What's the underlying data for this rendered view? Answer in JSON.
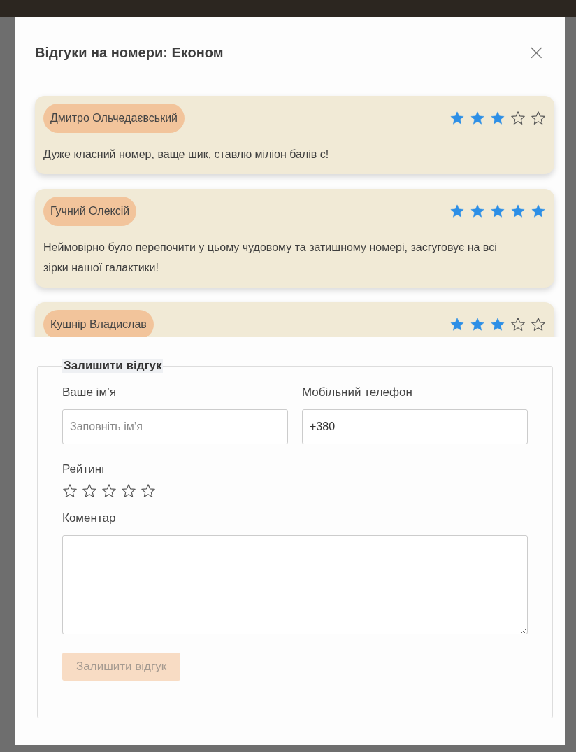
{
  "modal": {
    "title": "Відгуки на номери: Економ",
    "close": "×"
  },
  "reviews": [
    {
      "name": "Дмитро Ольчедаєвський",
      "stars": 3,
      "text": "Дуже класний номер, ваще шик, ставлю міліон балів с!"
    },
    {
      "name": "Гучний Олексій",
      "stars": 5,
      "text": "Неймовірно було перепочити у цьому чудовому та затишному номері, засгуговує на всі зірки нашої галактики!"
    },
    {
      "name": "Кушнір Владислав",
      "stars": 3
    }
  ],
  "form": {
    "legend": "Залишити відгук",
    "name_label": "Ваше ім’я",
    "name_placeholder": "Заповніть ім’я",
    "phone_label": "Мобільний телефон",
    "phone_value": "+380",
    "rating_label": "Рейтинг",
    "stars": 0,
    "comment_label": "Коментар",
    "submit": {
      "label": "Залишити відгук",
      "disabled": true
    }
  }
}
